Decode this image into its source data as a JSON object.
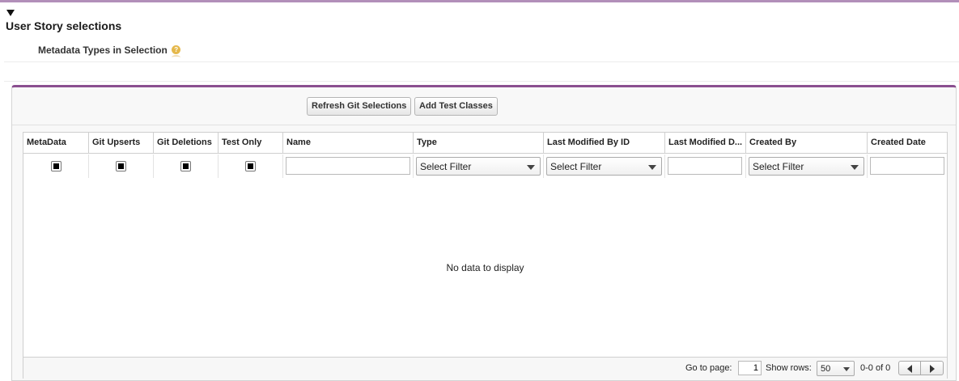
{
  "section": {
    "title": "User Story selections",
    "toggle_icon": "caret-down-icon",
    "subheader": "Metadata Types in Selection",
    "help_icon": "help-icon",
    "help_glyph": "?"
  },
  "colors": {
    "accent": "#8a4f8f",
    "top_rule": "#b28fb9",
    "help": "#e5b84b"
  },
  "toolbar": {
    "refresh_label": "Refresh Git Selections",
    "add_tests_label": "Add Test Classes"
  },
  "grid": {
    "columns": [
      {
        "label": "MetaData",
        "filter": "checkbox",
        "filter_checked": true
      },
      {
        "label": "Git Upserts",
        "filter": "checkbox",
        "filter_checked": true
      },
      {
        "label": "Git Deletions",
        "filter": "checkbox",
        "filter_checked": true
      },
      {
        "label": "Test Only",
        "filter": "checkbox",
        "filter_checked": true
      },
      {
        "label": "Name",
        "filter": "text",
        "filter_value": ""
      },
      {
        "label": "Type",
        "filter": "select",
        "filter_value": "Select Filter"
      },
      {
        "label": "Last Modified By ID",
        "filter": "select",
        "filter_value": "Select Filter"
      },
      {
        "label": "Last Modified D...",
        "filter": "text",
        "filter_value": ""
      },
      {
        "label": "Created By",
        "filter": "select",
        "filter_value": "Select Filter"
      },
      {
        "label": "Created Date",
        "filter": "text",
        "filter_value": ""
      }
    ],
    "empty_message": "No data to display"
  },
  "footer": {
    "goto_label": "Go to page:",
    "page_value": "1",
    "show_rows_label": "Show rows:",
    "rows_value": "50",
    "range_text": "0-0 of 0",
    "prev_icon": "chevron-left-icon",
    "next_icon": "chevron-right-icon"
  }
}
